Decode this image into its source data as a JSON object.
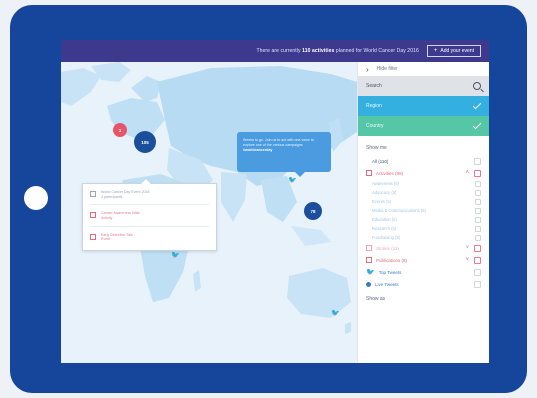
{
  "topbar": {
    "message_prefix": "There are currently",
    "message_count": "110 activities",
    "message_suffix": "planned for World Cancer Day 2016",
    "add_event_label": "Add your event"
  },
  "sidebar": {
    "hide_label": "Hide filter",
    "search_placeholder": "Search",
    "filters": [
      {
        "label": "Region"
      },
      {
        "label": "Country"
      }
    ],
    "show_me_title": "Show me",
    "all_label": "All (110)",
    "activities_label": "Activities (99)",
    "sub_items": [
      "Awareness (5)",
      "Advocacy (5)",
      "Events (5)",
      "Media & Communications (5)",
      "Education (5)",
      "Research (5)",
      "Fundraising (5)"
    ],
    "second_label": "Stories (11)",
    "publications_label": "Publications (8)",
    "twitter_label": "Top Tweets",
    "live_label": "Live Tweets",
    "show_as_title": "Show as"
  },
  "map": {
    "tooltip_text": "Weeks to go. Join us to act with one voice to explore one of the various campaigns",
    "tooltip_link": "#worldcancerday",
    "info_items": [
      {
        "title": "World Cancer Day Event 2016",
        "sub": "3 participants"
      },
      {
        "title": "Cancer Awareness Walk",
        "sub": "Activity"
      },
      {
        "title": "Early Detection Talk",
        "sub": "Event"
      }
    ],
    "markers": [
      {
        "label": "1",
        "color": "#e8556b"
      },
      {
        "label": "105",
        "color": "#1b4f9c"
      },
      {
        "label": "78",
        "color": "#1b4f9c"
      }
    ]
  },
  "colors": {
    "tablet": "#16459c",
    "topbar": "#3d3a8e",
    "filter_blue": "#33b0e0",
    "filter_green": "#55c7a6",
    "accent_red": "#e26b7e"
  }
}
